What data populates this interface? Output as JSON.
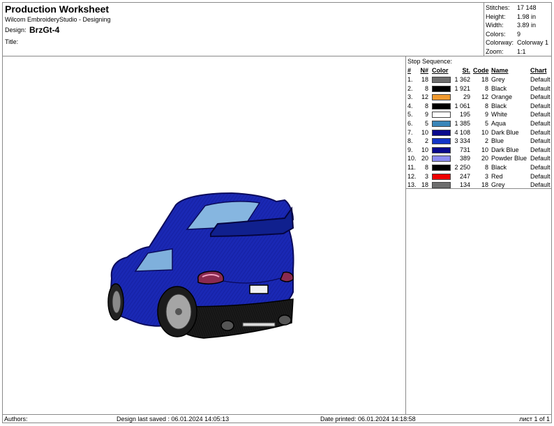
{
  "header": {
    "title": "Production Worksheet",
    "software": "Wilcom EmbroideryStudio - Designing",
    "design_label": "Design:",
    "design_value": "BrzGt-4",
    "title_label": "Title:"
  },
  "stats": [
    {
      "label": "Stitches:",
      "value": "17 148"
    },
    {
      "label": "Height:",
      "value": "1.98 in"
    },
    {
      "label": "Width:",
      "value": "3.89 in"
    },
    {
      "label": "Colors:",
      "value": "9"
    },
    {
      "label": "Colorway:",
      "value": "Colorway 1"
    },
    {
      "label": "Zoom:",
      "value": "1:1"
    }
  ],
  "stop_sequence": {
    "title": "Stop Sequence:",
    "columns": {
      "idx": "#",
      "n": "N#",
      "color": "Color",
      "st": "St.",
      "code": "Code",
      "name": "Name",
      "chart": "Chart"
    },
    "rows": [
      {
        "idx": "1.",
        "n": "18",
        "color": "#6e6e6e",
        "st": "1 362",
        "code": "18",
        "name": "Grey",
        "chart": "Default"
      },
      {
        "idx": "2.",
        "n": "8",
        "color": "#000000",
        "st": "1 921",
        "code": "8",
        "name": "Black",
        "chart": "Default"
      },
      {
        "idx": "3.",
        "n": "12",
        "color": "#f29a2e",
        "st": "29",
        "code": "12",
        "name": "Orange",
        "chart": "Default"
      },
      {
        "idx": "4.",
        "n": "8",
        "color": "#000000",
        "st": "1 061",
        "code": "8",
        "name": "Black",
        "chart": "Default"
      },
      {
        "idx": "5.",
        "n": "9",
        "color": "#ffffff",
        "st": "195",
        "code": "9",
        "name": "White",
        "chart": "Default"
      },
      {
        "idx": "6.",
        "n": "5",
        "color": "#3a86b8",
        "st": "1 385",
        "code": "5",
        "name": "Aqua",
        "chart": "Default"
      },
      {
        "idx": "7.",
        "n": "10",
        "color": "#0a0a8c",
        "st": "4 108",
        "code": "10",
        "name": "Dark Blue",
        "chart": "Default"
      },
      {
        "idx": "8.",
        "n": "2",
        "color": "#1436c8",
        "st": "3 334",
        "code": "2",
        "name": "Blue",
        "chart": "Default"
      },
      {
        "idx": "9.",
        "n": "10",
        "color": "#0a0a8c",
        "st": "731",
        "code": "10",
        "name": "Dark Blue",
        "chart": "Default"
      },
      {
        "idx": "10.",
        "n": "20",
        "color": "#8c8cf0",
        "st": "389",
        "code": "20",
        "name": "Powder Blue",
        "chart": "Default"
      },
      {
        "idx": "11.",
        "n": "8",
        "color": "#000000",
        "st": "2 250",
        "code": "8",
        "name": "Black",
        "chart": "Default"
      },
      {
        "idx": "12.",
        "n": "3",
        "color": "#ee0000",
        "st": "247",
        "code": "3",
        "name": "Red",
        "chart": "Default"
      },
      {
        "idx": "13.",
        "n": "18",
        "color": "#6e6e6e",
        "st": "134",
        "code": "18",
        "name": "Grey",
        "chart": "Default"
      }
    ]
  },
  "footer": {
    "authors": "Authors:",
    "saved": "Design last saved : 06.01.2024 14:05:13",
    "printed": "Date printed: 06.01.2024 14:18:58",
    "page": "лист 1 of 1"
  }
}
